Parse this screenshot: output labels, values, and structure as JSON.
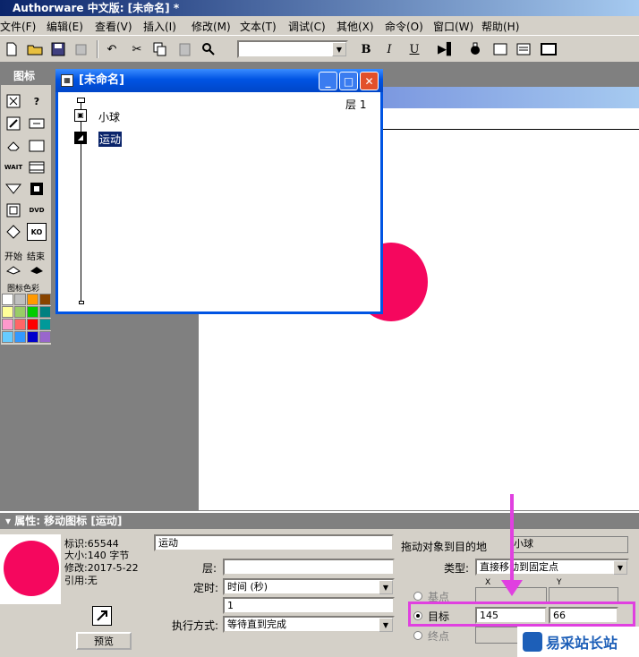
{
  "window": {
    "title": "Authorware 中文版: [未命名] *"
  },
  "menu": [
    "文件(F)",
    "编辑(E)",
    "查看(V)",
    "插入(I)",
    "修改(M)",
    "文本(T)",
    "调试(C)",
    "其他(X)",
    "命令(O)",
    "窗口(W)",
    "帮助(H)"
  ],
  "toolbar": {
    "bold": "B",
    "italic": "I",
    "underline": "U",
    "style_combo": ""
  },
  "palette": {
    "title": "图标",
    "wait_label": "WAIT",
    "dvd_label": "DVD",
    "ko_label": "KO",
    "start_label": "开始",
    "end_label": "结束",
    "colors_label": "图标色彩",
    "swatches": [
      "#ffffff",
      "#c0c0c0",
      "#ff9900",
      "#884400",
      "#ffff99",
      "#99cc66",
      "#00cc00",
      "#008080",
      "#ff99cc",
      "#ff6666",
      "#ff0000",
      "#009999",
      "#66ccff",
      "#3399ff",
      "#0000cc",
      "#9966cc"
    ]
  },
  "design_window": {
    "title": "[未命名]",
    "level": "层 1",
    "icons": [
      {
        "label": "小球",
        "type": "display-icon"
      },
      {
        "label": "运动",
        "type": "motion-icon",
        "selected": true
      }
    ]
  },
  "properties": {
    "title": "属性: 移动图标 [运动]",
    "info": {
      "id_label": "标识:",
      "id": "65544",
      "size_label": "大小:",
      "size": "140 字节",
      "modified_label": "修改:",
      "modified": "2017-5-22",
      "ref_label": "引用:",
      "ref": "无"
    },
    "preview_button": "预览",
    "name": "运动",
    "layer_label": "层:",
    "layer": "",
    "timing_label": "定时:",
    "timing": "时间 (秒)",
    "timing_value": "1",
    "exec_label": "执行方式:",
    "exec": "等待直到完成",
    "drag_label": "拖动对象到目的地",
    "drag_object": "小球",
    "type_label": "类型:",
    "type": "直接移动到固定点",
    "x_header": "X",
    "y_header": "Y",
    "base_label": "基点",
    "target_label": "目标",
    "end_label": "终点",
    "target_x": "145",
    "target_y": "66"
  },
  "watermark": {
    "text": "易采站长站"
  }
}
